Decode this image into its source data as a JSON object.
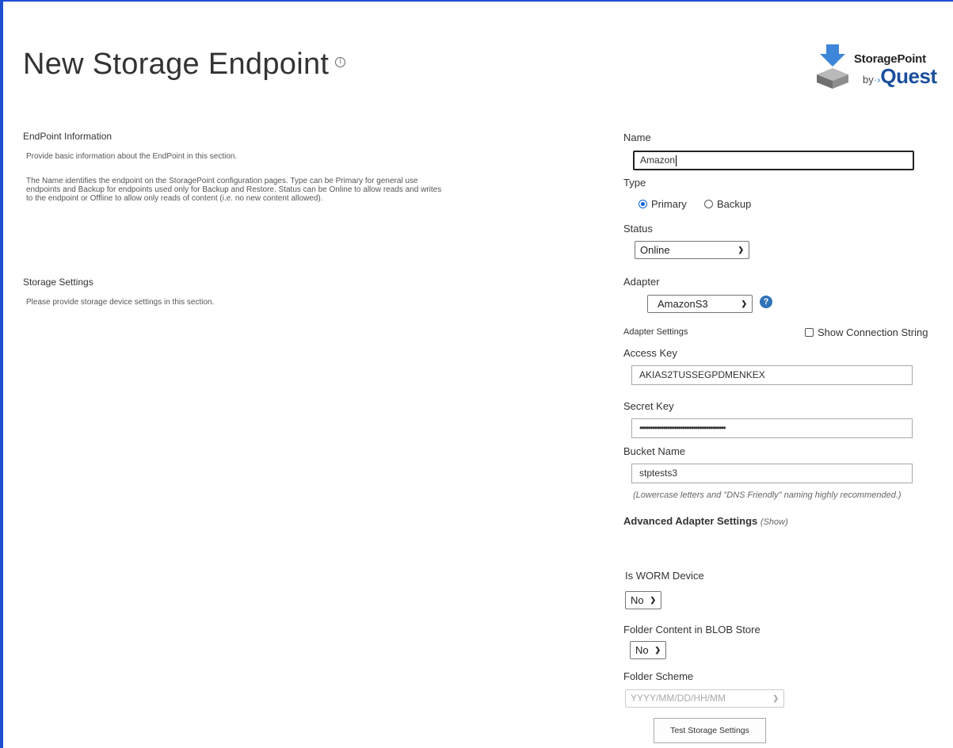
{
  "page": {
    "title": "New Storage Endpoint",
    "info_glyph": "i"
  },
  "logo": {
    "brand": "StoragePoint",
    "by": "by",
    "company": "Quest"
  },
  "sections": {
    "endpoint_info": {
      "heading": "EndPoint Information",
      "line1": "Provide basic information about the EndPoint in this section.",
      "line2": "The Name identifies the endpoint on the StoragePoint configuration pages. Type can be Primary for general use endpoints and Backup for endpoints used only for Backup and Restore. Status can be Online to allow reads and writes to the endpoint or Offline to allow only reads of content (i.e. no new content allowed)."
    },
    "storage_settings": {
      "heading": "Storage Settings",
      "line1": "Please provide storage device settings in this section."
    }
  },
  "form": {
    "name_label": "Name",
    "name_value": "Amazon",
    "type_label": "Type",
    "type_options": [
      "Primary",
      "Backup"
    ],
    "type_selected": "Primary",
    "status_label": "Status",
    "status_value": "Online",
    "adapter_label": "Adapter",
    "adapter_value": "AmazonS3",
    "adapter_help_glyph": "?",
    "adapter_settings_label": "Adapter Settings",
    "show_connection_string": "Show Connection String",
    "access_key_label": "Access Key",
    "access_key_value": "AKIAS2TUSSEGPDMENKEX",
    "secret_key_label": "Secret Key",
    "secret_key_value": "••••••••••••••••••••••••••••••••••••••••",
    "bucket_label": "Bucket Name",
    "bucket_value": "stptests3",
    "bucket_hint": "(Lowercase letters and \"DNS Friendly\" naming highly recommended.)",
    "advanced_label": "Advanced Adapter Settings",
    "advanced_toggle": "(Show)",
    "worm_label": "Is WORM Device",
    "worm_value": "No",
    "folder_content_label": "Folder Content in BLOB Store",
    "folder_content_value": "No",
    "folder_scheme_label": "Folder Scheme",
    "folder_scheme_value": "YYYY/MM/DD/HH/MM",
    "test_button": "Test Storage Settings"
  },
  "colors": {
    "frame": "#1f4fd1",
    "radio_accent": "#0a5fd6",
    "help_icon": "#2e72b8",
    "logo_blue": "#1b4f9c"
  }
}
